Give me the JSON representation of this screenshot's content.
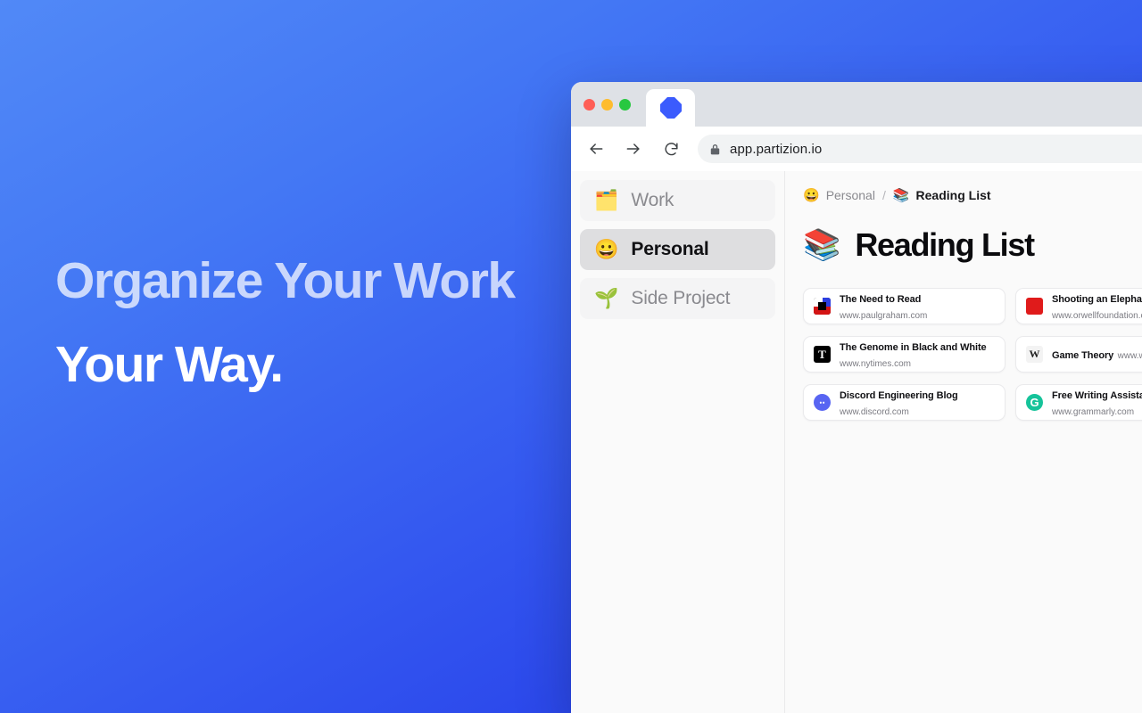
{
  "hero": {
    "line1": "Organize Your Work",
    "line2": "Your Way."
  },
  "browser": {
    "tab_icon": "partizion-logo-icon",
    "back_icon": "back-arrow-icon",
    "forward_icon": "forward-arrow-icon",
    "reload_icon": "reload-icon",
    "lock_icon": "lock-icon",
    "url": "app.partizion.io"
  },
  "sidebar": {
    "items": [
      {
        "emoji": "🗂️",
        "label": "Work",
        "active": false,
        "icon": "folder-emoji"
      },
      {
        "emoji": "😀",
        "label": "Personal",
        "active": true,
        "icon": "grinning-face-emoji"
      },
      {
        "emoji": "🌱",
        "label": "Side Project",
        "active": false,
        "icon": "seedling-emoji"
      }
    ]
  },
  "breadcrumb": {
    "parent_emoji": "😀",
    "parent": "Personal",
    "separator": "/",
    "current_emoji": "📚",
    "current": "Reading List"
  },
  "page": {
    "emoji": "📚",
    "title": "Reading List"
  },
  "bookmarks": [
    {
      "title": "The Need to Read",
      "url": "www.paulgraham.com",
      "favicon": "paulgraham-favicon",
      "fav_class": "fav-pg",
      "glyph": ""
    },
    {
      "title": "Shooting an Elephant",
      "url": "www.orwellfoundation.com",
      "favicon": "orwell-favicon",
      "fav_class": "fav-orwell",
      "glyph": ""
    },
    {
      "title": "The Genome in Black and White",
      "url": "www.nytimes.com",
      "favicon": "nytimes-favicon",
      "fav_class": "fav-nyt",
      "glyph": "T"
    },
    {
      "title": "Game Theory",
      "url": "www.wikipedia.com",
      "favicon": "wikipedia-favicon",
      "fav_class": "fav-wiki",
      "glyph": "W"
    },
    {
      "title": "Discord Engineering Blog",
      "url": "www.discord.com",
      "favicon": "discord-favicon",
      "fav_class": "fav-discord",
      "glyph": "●●"
    },
    {
      "title": "Free Writing Assistant",
      "url": "www.grammarly.com",
      "favicon": "grammarly-favicon",
      "fav_class": "fav-grammarly",
      "glyph": "G"
    }
  ],
  "colors": {
    "gradient_start": "#5189F7",
    "gradient_end": "#2438E6",
    "brand_blue": "#3B5BFD",
    "sidebar_active_bg": "#DEDEE0",
    "card_bg": "#FFFFFF"
  }
}
